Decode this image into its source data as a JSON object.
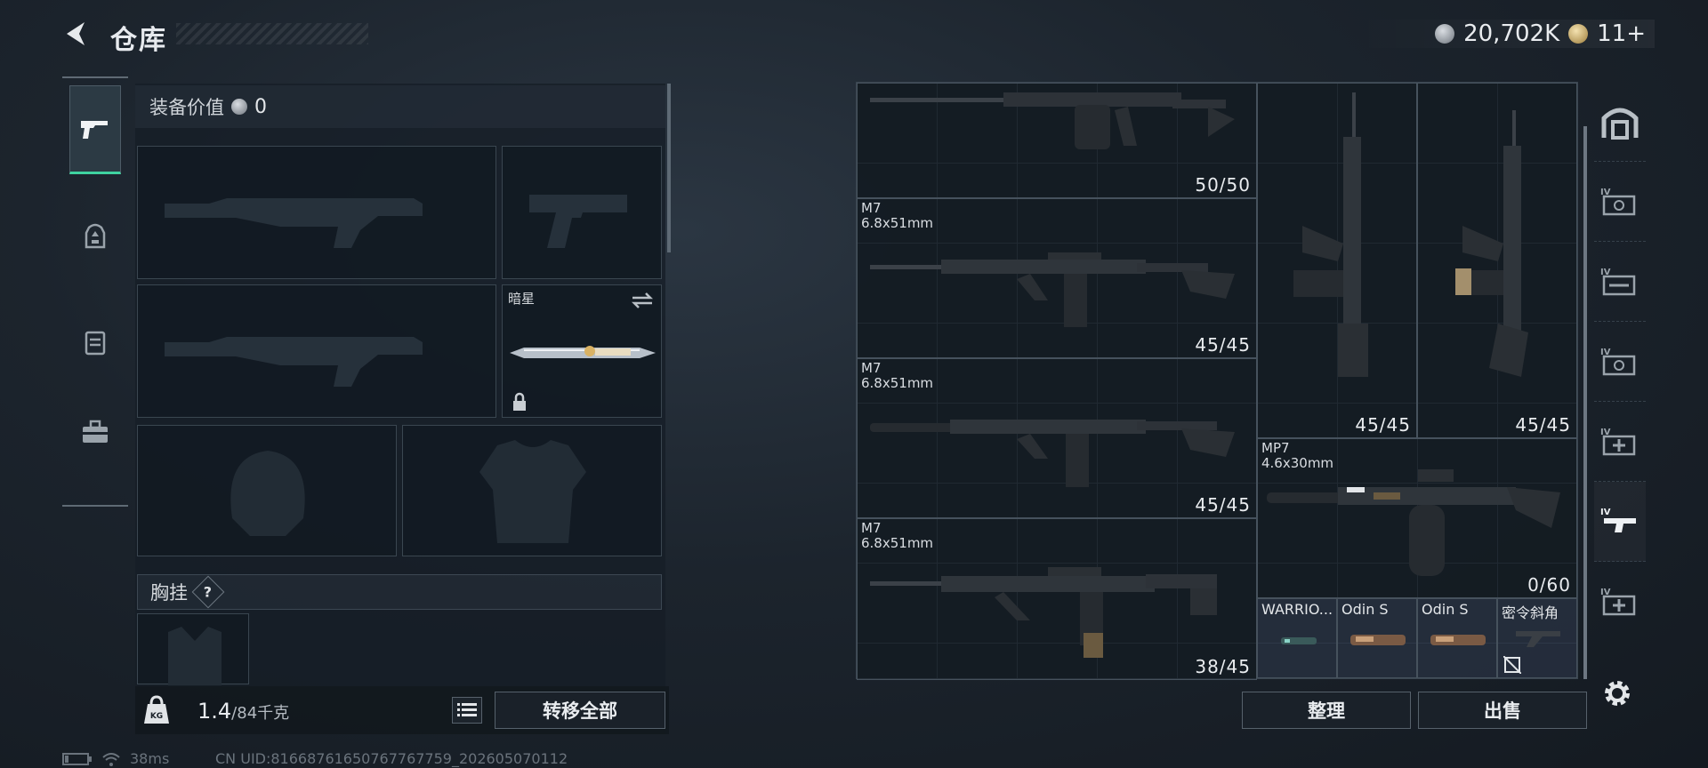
{
  "header": {
    "title": "仓库",
    "currency_silver": "20,702K",
    "currency_gold": "11+"
  },
  "left_tabs": [
    {
      "name": "weapons",
      "icon": "pistol-icon",
      "active": true
    },
    {
      "name": "armor",
      "icon": "backpack-icon",
      "active": false
    },
    {
      "name": "rig",
      "icon": "vest-icon",
      "active": false
    },
    {
      "name": "supplies",
      "icon": "toolbox-icon",
      "active": false
    }
  ],
  "equipment": {
    "value_label": "装备价值",
    "value": "0",
    "knife_name": "暗星",
    "chest_rig_label": "胸挂",
    "chest_rig_help": "?",
    "weight_current": "1.4",
    "weight_max": "/84千克",
    "transfer_all_label": "转移全部"
  },
  "inventory": {
    "items": [
      {
        "name": "",
        "caliber": "",
        "count": "50/50"
      },
      {
        "name": "M7",
        "caliber": "6.8x51mm",
        "count": "45/45"
      },
      {
        "name": "M7",
        "caliber": "6.8x51mm",
        "count": "45/45"
      },
      {
        "name": "M7",
        "caliber": "6.8x51mm",
        "count": "38/45"
      },
      {
        "name": "",
        "caliber": "",
        "count": "45/45"
      },
      {
        "name": "",
        "caliber": "",
        "count": "45/45"
      },
      {
        "name": "MP7",
        "caliber": "4.6x30mm",
        "count": "0/60"
      }
    ],
    "attachments": [
      "WARRIO...",
      "Odin S",
      "Odin S",
      "密令斜角"
    ],
    "sort_label": "整理",
    "sell_label": "出售"
  },
  "status": {
    "ping": "38ms",
    "uid": "CN UID:81668761650767767759_202605070112"
  }
}
